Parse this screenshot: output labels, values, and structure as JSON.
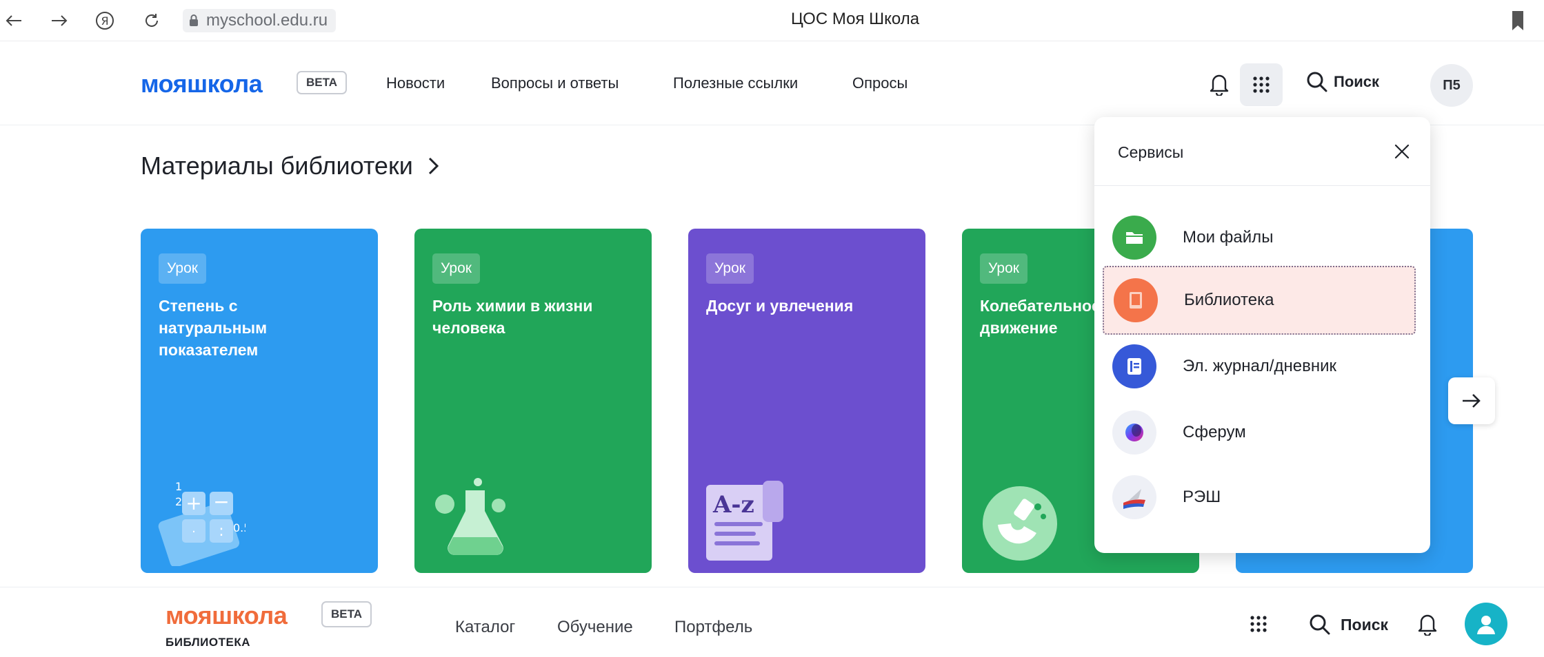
{
  "browser": {
    "url": "myschool.edu.ru",
    "window_title": "ЦОС Моя Школа"
  },
  "header": {
    "logo": "мояшкола",
    "badge": "BETA",
    "nav": [
      "Новости",
      "Вопросы и ответы",
      "Полезные ссылки",
      "Опросы"
    ],
    "search_label": "Поиск",
    "avatar_initials": "П5"
  },
  "section": {
    "title": "Материалы библиотеки"
  },
  "cards": [
    {
      "badge": "Урок",
      "title": "Степень с\nнатуральным\nпоказателем",
      "color": "#2d9bf0"
    },
    {
      "badge": "Урок",
      "title": "Роль химии в жизни\nчеловека",
      "color": "#21a659"
    },
    {
      "badge": "Урок",
      "title": "Досуг и увлечения",
      "color": "#6c4fcf"
    },
    {
      "badge": "Урок",
      "title": "Колебательное\nдвижение",
      "color": "#21a659"
    },
    {
      "color": "#2d9bf0"
    }
  ],
  "services": {
    "title": "Сервисы",
    "items": [
      {
        "label": "Мои файлы",
        "icon": "folder-icon",
        "color": "#3aab4c"
      },
      {
        "label": "Библиотека",
        "icon": "book-icon",
        "color": "#f4744a"
      },
      {
        "label": "Эл. журнал/дневник",
        "icon": "journal-icon",
        "color": "#3659d8"
      },
      {
        "label": "Сферум",
        "icon": "sferum-icon",
        "color": "#eef0f6"
      },
      {
        "label": "РЭШ",
        "icon": "resh-icon",
        "color": "#eef0f6"
      }
    ]
  },
  "bottom_header": {
    "logo": "мояшкола",
    "badge": "BETA",
    "subtitle": "БИБЛИОТЕКА",
    "nav": [
      "Каталог",
      "Обучение",
      "Портфель"
    ],
    "search_label": "Поиск"
  }
}
